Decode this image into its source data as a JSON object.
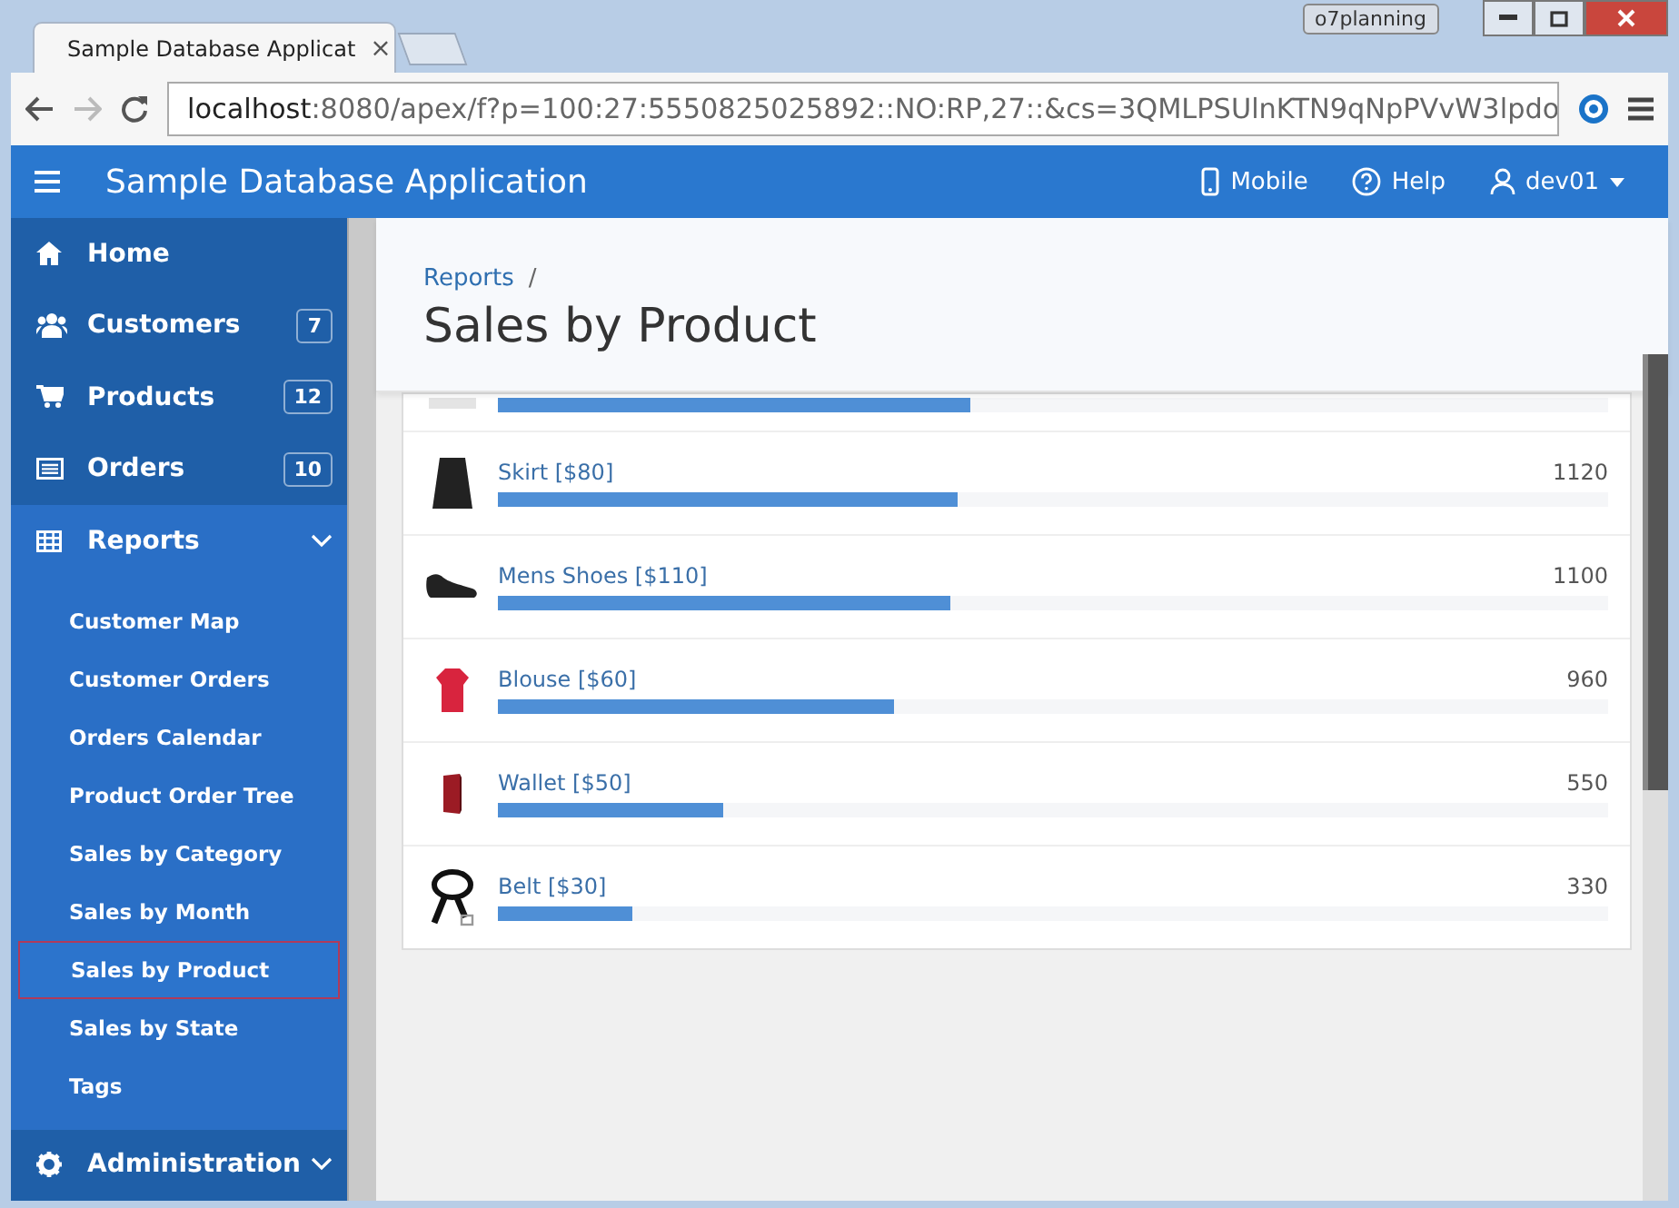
{
  "browser": {
    "profile": "o7planning",
    "tab": {
      "title": "Sample Database Applicat",
      "close": "×"
    },
    "url_host": "localhost",
    "url_rest": ":8080/apex/f?p=100:27:5550825025892::NO:RP,27::&cs=3QMLPSUlnKTN9qNpPVvW3lpdo"
  },
  "app": {
    "title": "Sample Database Application",
    "nav": [
      {
        "label": "Mobile",
        "kind": "mobile"
      },
      {
        "label": "Help",
        "kind": "help"
      },
      {
        "label": "dev01",
        "kind": "user"
      }
    ]
  },
  "sidebar": {
    "items": [
      {
        "label": "Home",
        "kind": "home",
        "collapsible": false,
        "expanded": false
      },
      {
        "label": "Customers",
        "kind": "users",
        "badge": "7",
        "collapsible": false,
        "expanded": false
      },
      {
        "label": "Products",
        "kind": "cart",
        "badge": "12",
        "collapsible": false,
        "expanded": false
      },
      {
        "label": "Orders",
        "kind": "list",
        "badge": "10",
        "collapsible": false,
        "expanded": false
      },
      {
        "label": "Reports",
        "kind": "grid",
        "collapsible": true,
        "expanded": true,
        "children": [
          {
            "label": "Customer Map",
            "selected": false
          },
          {
            "label": "Customer Orders",
            "selected": false
          },
          {
            "label": "Orders Calendar",
            "selected": false
          },
          {
            "label": "Product Order Tree",
            "selected": false
          },
          {
            "label": "Sales by Category",
            "selected": false
          },
          {
            "label": "Sales by Month",
            "selected": false
          },
          {
            "label": "Sales by Product",
            "selected": true
          },
          {
            "label": "Sales by State",
            "selected": false
          },
          {
            "label": "Tags",
            "selected": false
          }
        ]
      },
      {
        "label": "Administration",
        "kind": "gear",
        "collapsible": true,
        "expanded": false
      }
    ]
  },
  "page": {
    "breadcrumb": "Reports",
    "separator": "/",
    "title": "Sales by Product"
  },
  "products": [
    {
      "kind": "partial",
      "level": 0.426
    },
    {
      "kind": "skirt",
      "label": "Skirt [$80]",
      "value": "1120",
      "level": 0.414
    },
    {
      "kind": "shoes",
      "label": "Mens Shoes [$110]",
      "value": "1100",
      "level": 0.408
    },
    {
      "kind": "blouse",
      "label": "Blouse [$60]",
      "value": "960",
      "level": 0.356
    },
    {
      "kind": "wallet",
      "label": "Wallet [$50]",
      "value": "550",
      "level": 0.203
    },
    {
      "kind": "belt",
      "label": "Belt [$30]",
      "value": "330",
      "level": 0.121
    }
  ]
}
